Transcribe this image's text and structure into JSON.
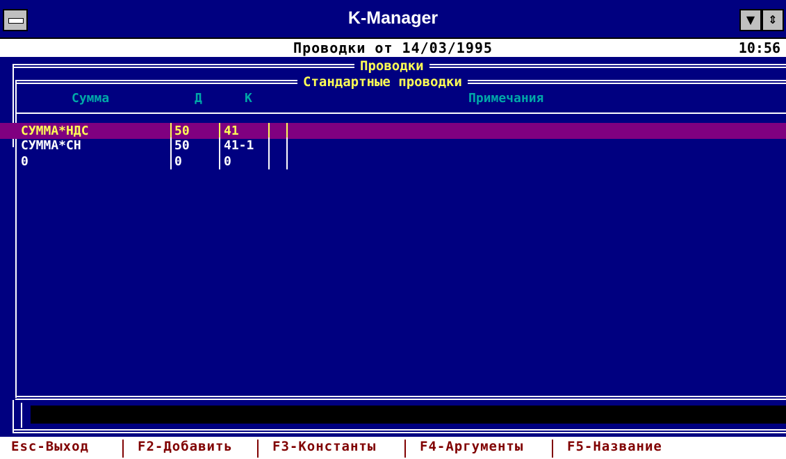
{
  "window": {
    "title": "K-Manager",
    "system_menu_icon": "system-menu-icon",
    "minimize_icon": "triangle-down-icon",
    "restore_icon": "up-down-arrows-icon"
  },
  "status": {
    "title": "Проводки от 14/03/1995",
    "time": "10:56"
  },
  "panels": {
    "outer_caption": "Проводки",
    "inner_caption": "Стандартные проводки"
  },
  "table": {
    "columns": {
      "sum": "Сумма",
      "debit": "Д",
      "credit": "К",
      "notes": "Примечания"
    },
    "rows": [
      {
        "sum": "СУММА*НДС",
        "debit": "50",
        "credit": "41",
        "extra": "",
        "notes": "",
        "selected": true
      },
      {
        "sum": "СУММА*СН",
        "debit": "50",
        "credit": "41-1",
        "extra": "",
        "notes": "",
        "selected": false
      },
      {
        "sum": "0",
        "debit": "0",
        "credit": "0",
        "extra": "",
        "notes": "",
        "selected": false
      }
    ]
  },
  "input": {
    "value": ""
  },
  "function_keys": [
    "Esc-Выход",
    "F2-Добавить",
    "F3-Константы",
    "F4-Аргументы",
    "F5-Название"
  ],
  "colors": {
    "background": "#000080",
    "selection": "#800080",
    "caption": "#ffff55",
    "column_header": "#00a8a8",
    "function_key_text": "#800000"
  }
}
